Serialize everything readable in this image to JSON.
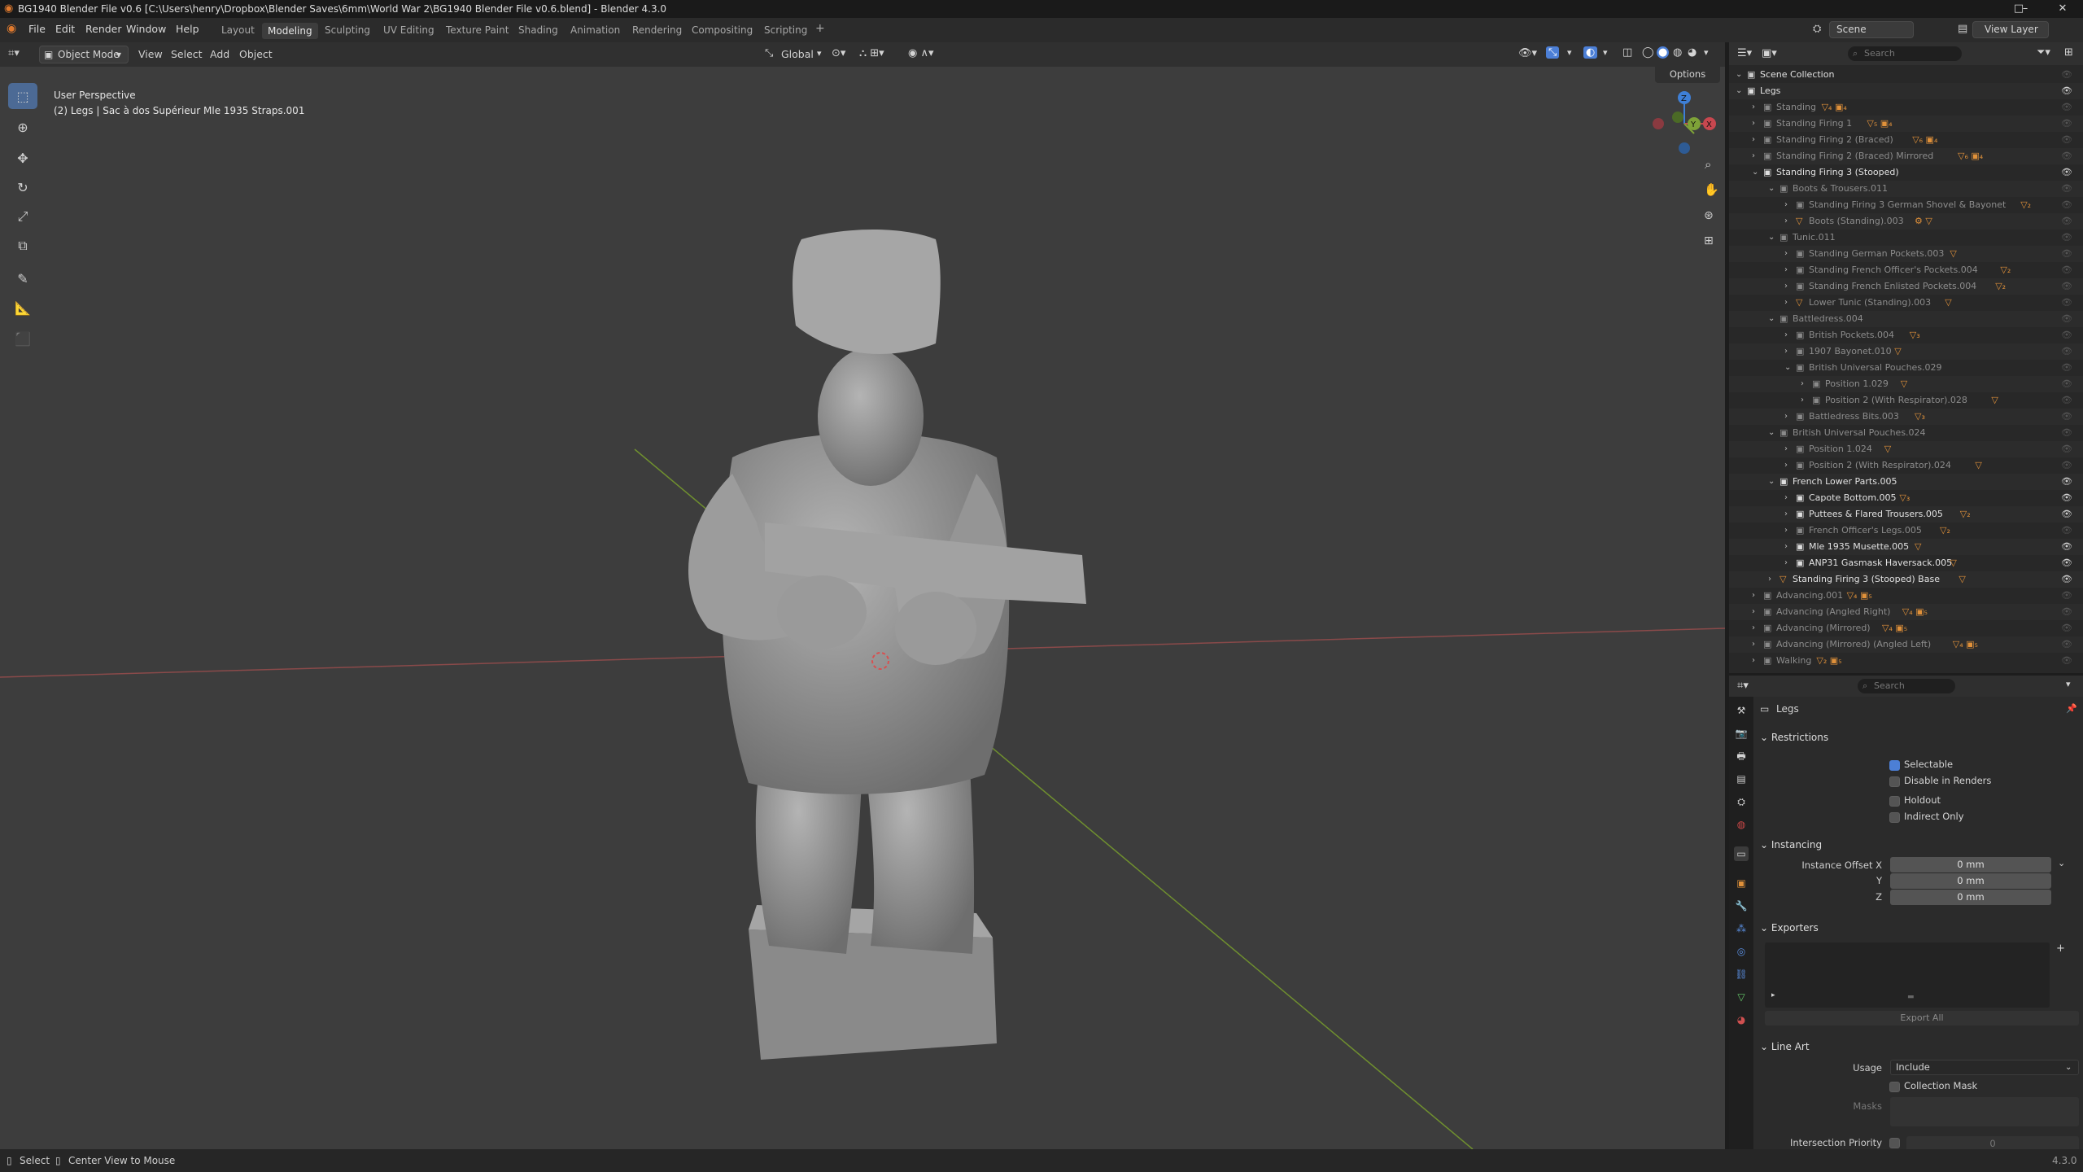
{
  "window": {
    "title": "BG1940 Blender File v0.6 [C:\\Users\\henry\\Dropbox\\Blender Saves\\6mm\\World War 2\\BG1940 Blender File v0.6.blend] - Blender 4.3.0",
    "minimize": "–",
    "maximize": "□",
    "close": "✕"
  },
  "menu": {
    "items": [
      "File",
      "Edit",
      "Render",
      "Window",
      "Help"
    ],
    "workspaces": [
      "Layout",
      "Modeling",
      "Sculpting",
      "UV Editing",
      "Texture Paint",
      "Shading",
      "Animation",
      "Rendering",
      "Compositing",
      "Scripting"
    ],
    "active_workspace": "Modeling",
    "add_workspace": "+",
    "scene_label": "Scene",
    "view_layer_label": "View Layer"
  },
  "viewport_header": {
    "mode": "Object Mode",
    "view": "View",
    "select": "Select",
    "add": "Add",
    "object": "Object",
    "orientation": "Global",
    "options": "Options"
  },
  "viewport": {
    "perspective_label": "User Perspective",
    "object_info": "(2) Legs | Sac à dos Supérieur Mle 1935 Straps.001"
  },
  "outliner": {
    "search_placeholder": "Search",
    "rows": [
      {
        "name": "Scene Collection",
        "level": 0,
        "expanded": true,
        "icon": "scene",
        "bright": true,
        "tag": "",
        "eye": false
      },
      {
        "name": "Legs",
        "level": 0,
        "expanded": true,
        "icon": "collection",
        "bright": true,
        "tag": "",
        "eye": true
      },
      {
        "name": "Standing",
        "level": 1,
        "expanded": false,
        "icon": "collection",
        "bright": false,
        "tag": "▽₄ ▣₄",
        "eye": false
      },
      {
        "name": "Standing Firing 1",
        "level": 1,
        "expanded": false,
        "icon": "collection",
        "bright": false,
        "tag": "▽₅ ▣₄",
        "eye": false
      },
      {
        "name": "Standing Firing 2 (Braced)",
        "level": 1,
        "expanded": false,
        "icon": "collection",
        "bright": false,
        "tag": "▽₆ ▣₄",
        "eye": false
      },
      {
        "name": "Standing Firing 2 (Braced) Mirrored",
        "level": 1,
        "expanded": false,
        "icon": "collection",
        "bright": false,
        "tag": "▽₆ ▣₄",
        "eye": false
      },
      {
        "name": "Standing Firing 3 (Stooped)",
        "level": 1,
        "expanded": true,
        "icon": "collection",
        "bright": true,
        "tag": "",
        "eye": true
      },
      {
        "name": "Boots & Trousers.011",
        "level": 2,
        "expanded": true,
        "icon": "collection",
        "bright": false,
        "tag": "",
        "eye": false
      },
      {
        "name": "Standing Firing 3 German Shovel & Bayonet",
        "level": 3,
        "expanded": false,
        "icon": "collection",
        "bright": false,
        "tag": "▽₂",
        "eye": false
      },
      {
        "name": "Boots (Standing).003",
        "level": 3,
        "expanded": false,
        "icon": "mesh",
        "bright": false,
        "tag": "⚙ ▽",
        "eye": false
      },
      {
        "name": "Tunic.011",
        "level": 2,
        "expanded": true,
        "icon": "collection",
        "bright": false,
        "tag": "",
        "eye": false
      },
      {
        "name": "Standing German Pockets.003",
        "level": 3,
        "expanded": false,
        "icon": "collection",
        "bright": false,
        "tag": "▽",
        "eye": false
      },
      {
        "name": "Standing French Officer's Pockets.004",
        "level": 3,
        "expanded": false,
        "icon": "collection",
        "bright": false,
        "tag": "▽₂",
        "eye": false
      },
      {
        "name": "Standing French Enlisted Pockets.004",
        "level": 3,
        "expanded": false,
        "icon": "collection",
        "bright": false,
        "tag": "▽₂",
        "eye": false
      },
      {
        "name": "Lower Tunic (Standing).003",
        "level": 3,
        "expanded": false,
        "icon": "mesh",
        "bright": false,
        "tag": "▽",
        "eye": false
      },
      {
        "name": "Battledress.004",
        "level": 2,
        "expanded": true,
        "icon": "collection",
        "bright": false,
        "tag": "",
        "eye": false
      },
      {
        "name": "British Pockets.004",
        "level": 3,
        "expanded": false,
        "icon": "collection",
        "bright": false,
        "tag": "▽₃",
        "eye": false
      },
      {
        "name": "1907 Bayonet.010",
        "level": 3,
        "expanded": false,
        "icon": "collection",
        "bright": false,
        "tag": "▽",
        "eye": false
      },
      {
        "name": "British Universal Pouches.029",
        "level": 3,
        "expanded": true,
        "icon": "collection",
        "bright": false,
        "tag": "",
        "eye": false
      },
      {
        "name": "Position 1.029",
        "level": 4,
        "expanded": false,
        "icon": "collection",
        "bright": false,
        "tag": "▽",
        "eye": false
      },
      {
        "name": "Position 2 (With Respirator).028",
        "level": 4,
        "expanded": false,
        "icon": "collection",
        "bright": false,
        "tag": "▽",
        "eye": false
      },
      {
        "name": "Battledress Bits.003",
        "level": 3,
        "expanded": false,
        "icon": "collection",
        "bright": false,
        "tag": "▽₃",
        "eye": false
      },
      {
        "name": "British Universal Pouches.024",
        "level": 2,
        "expanded": true,
        "icon": "collection",
        "bright": false,
        "tag": "",
        "eye": false
      },
      {
        "name": "Position 1.024",
        "level": 3,
        "expanded": false,
        "icon": "collection",
        "bright": false,
        "tag": "▽",
        "eye": false
      },
      {
        "name": "Position 2 (With Respirator).024",
        "level": 3,
        "expanded": false,
        "icon": "collection",
        "bright": false,
        "tag": "▽",
        "eye": false
      },
      {
        "name": "French Lower Parts.005",
        "level": 2,
        "expanded": true,
        "icon": "collection",
        "bright": true,
        "tag": "",
        "eye": true
      },
      {
        "name": "Capote Bottom.005",
        "level": 3,
        "expanded": false,
        "icon": "collection",
        "bright": true,
        "tag": "▽₃",
        "eye": true
      },
      {
        "name": "Puttees & Flared Trousers.005",
        "level": 3,
        "expanded": false,
        "icon": "collection",
        "bright": true,
        "tag": "▽₂",
        "eye": true
      },
      {
        "name": "French Officer's Legs.005",
        "level": 3,
        "expanded": false,
        "icon": "collection",
        "bright": false,
        "tag": "▽₂",
        "eye": false
      },
      {
        "name": "Mle 1935 Musette.005",
        "level": 3,
        "expanded": false,
        "icon": "collection",
        "bright": true,
        "tag": "▽",
        "eye": true
      },
      {
        "name": "ANP31 Gasmask Haversack.005",
        "level": 3,
        "expanded": false,
        "icon": "collection",
        "bright": true,
        "tag": "▽",
        "eye": true
      },
      {
        "name": "Standing Firing 3 (Stooped) Base",
        "level": 2,
        "expanded": false,
        "icon": "mesh",
        "bright": true,
        "tag": "▽",
        "eye": true
      },
      {
        "name": "Advancing.001",
        "level": 1,
        "expanded": false,
        "icon": "collection",
        "bright": false,
        "tag": "▽₄ ▣₅",
        "eye": false
      },
      {
        "name": "Advancing (Angled Right)",
        "level": 1,
        "expanded": false,
        "icon": "collection",
        "bright": false,
        "tag": "▽₄ ▣₅",
        "eye": false
      },
      {
        "name": "Advancing (Mirrored)",
        "level": 1,
        "expanded": false,
        "icon": "collection",
        "bright": false,
        "tag": "▽₄ ▣₅",
        "eye": false
      },
      {
        "name": "Advancing (Mirrored) (Angled Left)",
        "level": 1,
        "expanded": false,
        "icon": "collection",
        "bright": false,
        "tag": "▽₄ ▣₅",
        "eye": false
      },
      {
        "name": "Walking",
        "level": 1,
        "expanded": false,
        "icon": "collection",
        "bright": false,
        "tag": "▽₂ ▣₅",
        "eye": false
      }
    ]
  },
  "properties": {
    "search_placeholder": "Search",
    "collection_name": "Legs",
    "restrictions": {
      "title": "Restrictions",
      "selectable": "Selectable",
      "disable_renders": "Disable in Renders",
      "holdout": "Holdout",
      "indirect_only": "Indirect Only"
    },
    "instancing": {
      "title": "Instancing",
      "offset_x_label": "Instance Offset X",
      "y_label": "Y",
      "z_label": "Z",
      "x": "0 mm",
      "y": "0 mm",
      "z": "0 mm"
    },
    "exporters": {
      "title": "Exporters",
      "export_all": "Export All",
      "add": "+"
    },
    "line_art": {
      "title": "Line Art",
      "usage_label": "Usage",
      "usage_value": "Include",
      "collection_mask": "Collection Mask",
      "masks_label": "Masks",
      "intersection_priority_label": "Intersection Priority",
      "intersection_priority_value": "0"
    }
  },
  "status": {
    "select": "Select",
    "center_view": "Center View to Mouse",
    "version": "4.3.0"
  },
  "colors": {
    "accent": "#4c7fd6",
    "active_tool": "#4c6a95",
    "x_axis": "#c8474f",
    "y_axis": "#7ea238",
    "z_axis": "#3e7fd6",
    "viewport_bg": "#3d3d3d",
    "orange_icon": "#e0913a",
    "green_icon": "#67c96a"
  }
}
